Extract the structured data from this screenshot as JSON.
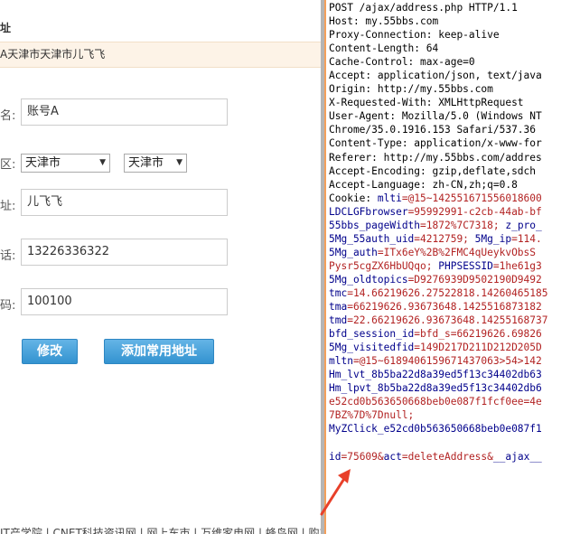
{
  "form": {
    "section_title": "址",
    "current_address": "A天津市天津市儿飞飞",
    "fields": [
      {
        "label": "名:",
        "value": "账号A"
      },
      {
        "label": "区:",
        "province": "天津市",
        "city": "天津市"
      },
      {
        "label": "址:",
        "value": "儿飞飞"
      },
      {
        "label": "话:",
        "value": "13226336322"
      },
      {
        "label": "码:",
        "value": "100100"
      }
    ],
    "modify_button": "修改",
    "add_common_button": "添加常用地址",
    "footer_links": "IT产学院 | CNET科技资讯网 | 网上车市 | 万维家电网 | 蜂鸟网 | 购车"
  },
  "request": {
    "headers": [
      {
        "text": "POST /ajax/address.php HTTP/1.1",
        "kind": "k"
      },
      {
        "text": "Host: my.55bbs.com",
        "kind": "k"
      },
      {
        "text": "Proxy-Connection: keep-alive",
        "kind": "k"
      },
      {
        "text": "Content-Length: 64",
        "kind": "k"
      },
      {
        "text": "Cache-Control: max-age=0",
        "kind": "k"
      },
      {
        "text": "Accept: application/json, text/java",
        "kind": "k"
      },
      {
        "text": "Origin: http://my.55bbs.com",
        "kind": "k"
      },
      {
        "text": "X-Requested-With: XMLHttpRequest",
        "kind": "k"
      },
      {
        "text": "User-Agent: Mozilla/5.0 (Windows NT",
        "kind": "k"
      },
      {
        "text": "Chrome/35.0.1916.153 Safari/537.36",
        "kind": "k"
      },
      {
        "text": "Content-Type: application/x-www-for",
        "kind": "k"
      },
      {
        "text": "Referer: http://my.55bbs.com/addres",
        "kind": "k"
      },
      {
        "text": "Accept-Encoding: gzip,deflate,sdch",
        "kind": "k"
      },
      {
        "text": "Accept-Language: zh-CN,zh;q=0.8",
        "kind": "k"
      }
    ],
    "cookie_lines": [
      [
        {
          "t": "Cookie: ",
          "c": "k"
        },
        {
          "t": "mlti",
          "c": "blue"
        },
        {
          "t": "=@15~142551671556018600",
          "c": "red"
        }
      ],
      [
        {
          "t": "LDCLGFbrowser",
          "c": "blue"
        },
        {
          "t": "=95992991-c2cb-44ab-bf",
          "c": "red"
        }
      ],
      [
        {
          "t": "55bbs_pageWidth",
          "c": "blue"
        },
        {
          "t": "=1872%7C7318; ",
          "c": "red"
        },
        {
          "t": "z_pro_",
          "c": "blue"
        }
      ],
      [
        {
          "t": "5Mg_55auth_uid",
          "c": "blue"
        },
        {
          "t": "=4212759; ",
          "c": "red"
        },
        {
          "t": "5Mg_ip",
          "c": "blue"
        },
        {
          "t": "=114.",
          "c": "red"
        }
      ],
      [
        {
          "t": "5Mg_auth",
          "c": "blue"
        },
        {
          "t": "=ITx6eY%2B%2FMC4qUeykvObsS",
          "c": "red"
        }
      ],
      [
        {
          "t": "Pysr5cgZX6HbUQqo; ",
          "c": "red"
        },
        {
          "t": "PHPSESSID",
          "c": "blue"
        },
        {
          "t": "=1he61g3",
          "c": "red"
        }
      ],
      [
        {
          "t": "5Mg_oldtopics",
          "c": "blue"
        },
        {
          "t": "=D9276939D9502190D9492",
          "c": "red"
        }
      ],
      [
        {
          "t": "tmc",
          "c": "blue"
        },
        {
          "t": "=14.66219626.27522818.14260465185",
          "c": "red"
        }
      ],
      [
        {
          "t": "tma",
          "c": "blue"
        },
        {
          "t": "=66219626.93673648.1425516873182",
          "c": "red"
        }
      ],
      [
        {
          "t": "tmd",
          "c": "blue"
        },
        {
          "t": "=22.66219626.93673648.14255168737",
          "c": "red"
        }
      ],
      [
        {
          "t": "bfd_session_id",
          "c": "blue"
        },
        {
          "t": "=bfd_s=66219626.69826",
          "c": "red"
        }
      ],
      [
        {
          "t": "5Mg_visitedfid",
          "c": "blue"
        },
        {
          "t": "=149D217D211D212D205D",
          "c": "red"
        }
      ],
      [
        {
          "t": "mltn",
          "c": "blue"
        },
        {
          "t": "=@15~6189406159671437063>54>142",
          "c": "red"
        }
      ],
      [
        {
          "t": "Hm_lvt_8b5ba22d8a39ed5f13c34402db63",
          "c": "blue"
        }
      ],
      [
        {
          "t": "Hm_lpvt_8b5ba22d8a39ed5f13c34402db6",
          "c": "blue"
        }
      ],
      [
        {
          "t": "e52cd0b563650668beb0e087f1fcf0ee=4e",
          "c": "red"
        }
      ],
      [
        {
          "t": "7BZ%7D%7Dnull;",
          "c": "red"
        }
      ],
      [
        {
          "t": "MyZClick_e52cd0b563650668beb0e087f1",
          "c": "blue"
        }
      ]
    ],
    "body_line": [
      {
        "t": "id",
        "c": "blue"
      },
      {
        "t": "=75609&",
        "c": "red"
      },
      {
        "t": "act",
        "c": "blue"
      },
      {
        "t": "=deleteAddress&",
        "c": "red"
      },
      {
        "t": "__ajax__",
        "c": "blue"
      }
    ]
  },
  "colors": {
    "arrow": "#e8402a",
    "button": "#3c9ad6",
    "address_bg": "#fdf3e7"
  }
}
